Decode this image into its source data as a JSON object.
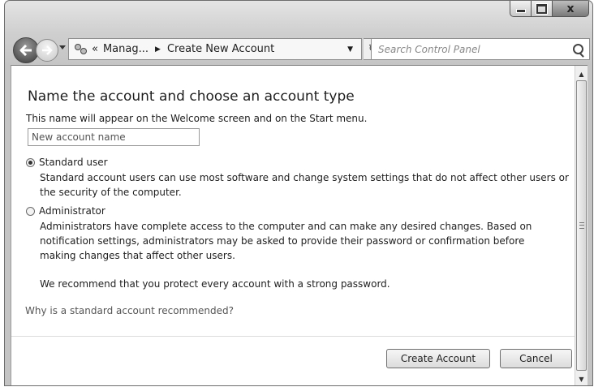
{
  "window": {
    "min_glyph": "",
    "close_glyph": "x"
  },
  "navbar": {
    "breadcrumb_chevron": "«",
    "breadcrumb": [
      "Manag...",
      "Create New Account"
    ],
    "breadcrumb_separator": "▶",
    "dropdown_glyph": "▼",
    "refresh_glyph": "↻",
    "search_placeholder": "Search Control Panel"
  },
  "main": {
    "heading": "Name the account and choose an account type",
    "description": "This name will appear on the Welcome screen and on the Start menu.",
    "name_placeholder": "New account name",
    "options": [
      {
        "label": "Standard user",
        "checked": true,
        "description": "Standard account users can use most software and change system settings that do not affect other users or the security of the computer."
      },
      {
        "label": "Administrator",
        "checked": false,
        "description": "Administrators have complete access to the computer and can make any desired changes. Based on notification settings, administrators may be asked to provide their password or confirmation before making changes that affect other users."
      }
    ],
    "recommendation": "We recommend that you protect every account with a strong password.",
    "help_link": "Why is a standard account recommended?",
    "buttons": {
      "create": "Create Account",
      "cancel": "Cancel"
    }
  },
  "icons": {
    "back": "back-arrow-icon",
    "forward": "forward-arrow-icon",
    "users": "user-accounts-icon",
    "search": "search-icon"
  }
}
